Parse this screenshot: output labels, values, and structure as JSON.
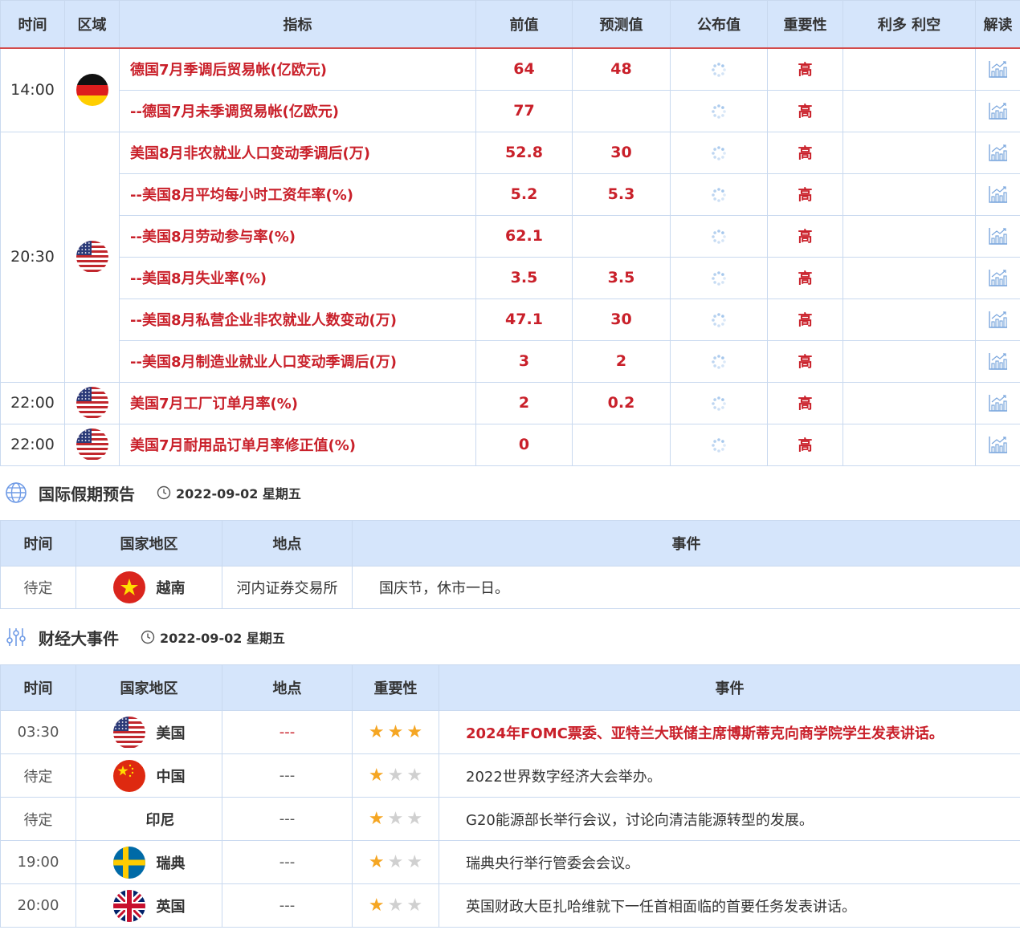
{
  "calendar": {
    "headers": [
      "时间",
      "区域",
      "指标",
      "前值",
      "预测值",
      "公布值",
      "重要性",
      "利多 利空",
      "解读"
    ],
    "rows": [
      {
        "time": "14:00",
        "flag": "germany",
        "indicator": "德国7月季调后贸易帐(亿欧元)",
        "prev": "64",
        "forecast": "48",
        "importance": "高"
      },
      {
        "time": "",
        "flag": "",
        "indicator": "--德国7月未季调贸易帐(亿欧元)",
        "prev": "77",
        "forecast": "",
        "importance": "高"
      },
      {
        "time": "20:30",
        "flag": "usa",
        "indicator": "美国8月非农就业人口变动季调后(万)",
        "prev": "52.8",
        "forecast": "30",
        "importance": "高"
      },
      {
        "time": "",
        "flag": "",
        "indicator": "--美国8月平均每小时工资年率(%)",
        "prev": "5.2",
        "forecast": "5.3",
        "importance": "高"
      },
      {
        "time": "",
        "flag": "",
        "indicator": "--美国8月劳动参与率(%)",
        "prev": "62.1",
        "forecast": "",
        "importance": "高"
      },
      {
        "time": "",
        "flag": "",
        "indicator": "--美国8月失业率(%)",
        "prev": "3.5",
        "forecast": "3.5",
        "importance": "高"
      },
      {
        "time": "",
        "flag": "",
        "indicator": "--美国8月私营企业非农就业人数变动(万)",
        "prev": "47.1",
        "forecast": "30",
        "importance": "高"
      },
      {
        "time": "",
        "flag": "",
        "indicator": "--美国8月制造业就业人口变动季调后(万)",
        "prev": "3",
        "forecast": "2",
        "importance": "高"
      },
      {
        "time": "22:00",
        "flag": "usa",
        "indicator": "美国7月工厂订单月率(%)",
        "prev": "2",
        "forecast": "0.2",
        "importance": "高"
      },
      {
        "time": "22:00",
        "flag": "usa",
        "indicator": "美国7月耐用品订单月率修正值(%)",
        "prev": "0",
        "forecast": "",
        "importance": "高"
      }
    ]
  },
  "holidays": {
    "title": "国际假期预告",
    "date": "2022-09-02 星期五",
    "icon": "globe-icon",
    "headers": [
      "时间",
      "国家地区",
      "地点",
      "事件"
    ],
    "rows": [
      {
        "time": "待定",
        "country": "越南",
        "flag": "vietnam",
        "place": "河内证券交易所",
        "event": "国庆节，休市一日。"
      }
    ]
  },
  "events": {
    "title": "财经大事件",
    "date": "2022-09-02 星期五",
    "icon": "sliders-icon",
    "headers": [
      "时间",
      "国家地区",
      "地点",
      "重要性",
      "事件"
    ],
    "rows": [
      {
        "time": "03:30",
        "country": "美国",
        "flag": "usa",
        "place": "---",
        "stars": 3,
        "event": "2024年FOMC票委、亚特兰大联储主席博斯蒂克向商学院学生发表讲话。",
        "highlight": true
      },
      {
        "time": "待定",
        "country": "中国",
        "flag": "china",
        "place": "---",
        "stars": 1,
        "event": "2022世界数字经济大会举办。",
        "highlight": false
      },
      {
        "time": "待定",
        "country": "印尼",
        "flag": "",
        "place": "---",
        "stars": 1,
        "event": "G20能源部长举行会议，讨论向清洁能源转型的发展。",
        "highlight": false
      },
      {
        "time": "19:00",
        "country": "瑞典",
        "flag": "sweden",
        "place": "---",
        "stars": 1,
        "event": "瑞典央行举行管委会会议。",
        "highlight": false
      },
      {
        "time": "20:00",
        "country": "英国",
        "flag": "uk",
        "place": "---",
        "stars": 1,
        "event": "英国财政大臣扎哈维就下一任首相面临的首要任务发表讲话。",
        "highlight": false
      }
    ]
  },
  "icons": {
    "pending": "loading-spinner-icon",
    "chart": "chart-analysis-icon",
    "clock": "clock-icon",
    "star": "star-icon"
  },
  "colors": {
    "header_bg": "#d5e5fb",
    "border": "#c9d9ef",
    "accent_red": "#c9202a",
    "header_divider": "#d34b4b",
    "star_on": "#f5a623",
    "star_off": "#d0d0d0"
  }
}
